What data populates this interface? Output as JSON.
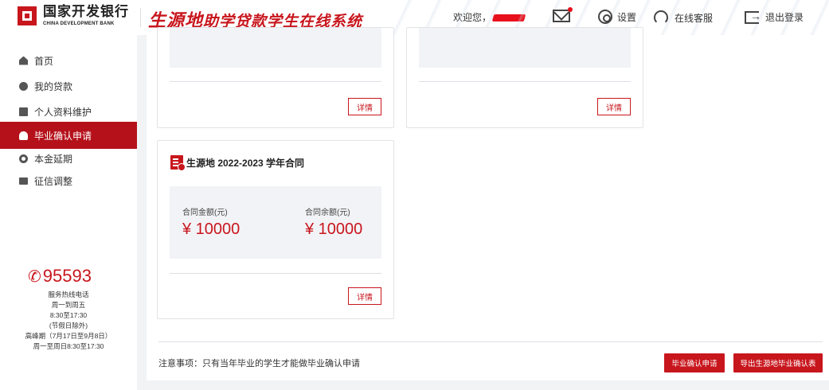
{
  "header": {
    "bank_name_cn": "国家开发银行",
    "bank_name_en": "CHINA DEVELOPMENT BANK",
    "system_title_main": "生源地",
    "system_title_rest": "助学贷款学生在线系统",
    "welcome": "欢迎您，",
    "settings_label": "设置",
    "service_label": "在线客服",
    "logout_label": "退出登录"
  },
  "sidebar": {
    "items": [
      {
        "label": "首页",
        "icon": "home-icon"
      },
      {
        "label": "我的贷款",
        "icon": "loan-icon"
      },
      {
        "label": "个人资料维护",
        "icon": "profile-icon"
      },
      {
        "label": "毕业确认申请",
        "icon": "graduate-icon",
        "active": true
      },
      {
        "label": "本金延期",
        "icon": "deferral-icon"
      },
      {
        "label": "征信调整",
        "icon": "credit-icon"
      }
    ],
    "hotline": {
      "number": "95593",
      "lines": [
        "服务热线电话",
        "周一到周五",
        "8:30至17:30",
        "(节假日除外)",
        "高峰期（7月17日至9月8日）",
        "周一至周日8:30至17:30"
      ]
    }
  },
  "main": {
    "cards_top": [
      {
        "detail_label": "详情"
      },
      {
        "detail_label": "详情"
      }
    ],
    "contract_card": {
      "title": "生源地 2022-2023 学年合同",
      "amount_label": "合同金额(元)",
      "amount_value": "¥ 10000",
      "balance_label": "合同余额(元)",
      "balance_value": "¥ 10000",
      "detail_label": "详情"
    },
    "notice": "注意事项：只有当年毕业的学生才能做毕业确认申请",
    "btn_apply": "毕业确认申请",
    "btn_export": "导出生源地毕业确认表"
  },
  "colors": {
    "brand_red": "#c8161d",
    "active_nav": "#b5111b",
    "background": "#f2f3f5"
  }
}
